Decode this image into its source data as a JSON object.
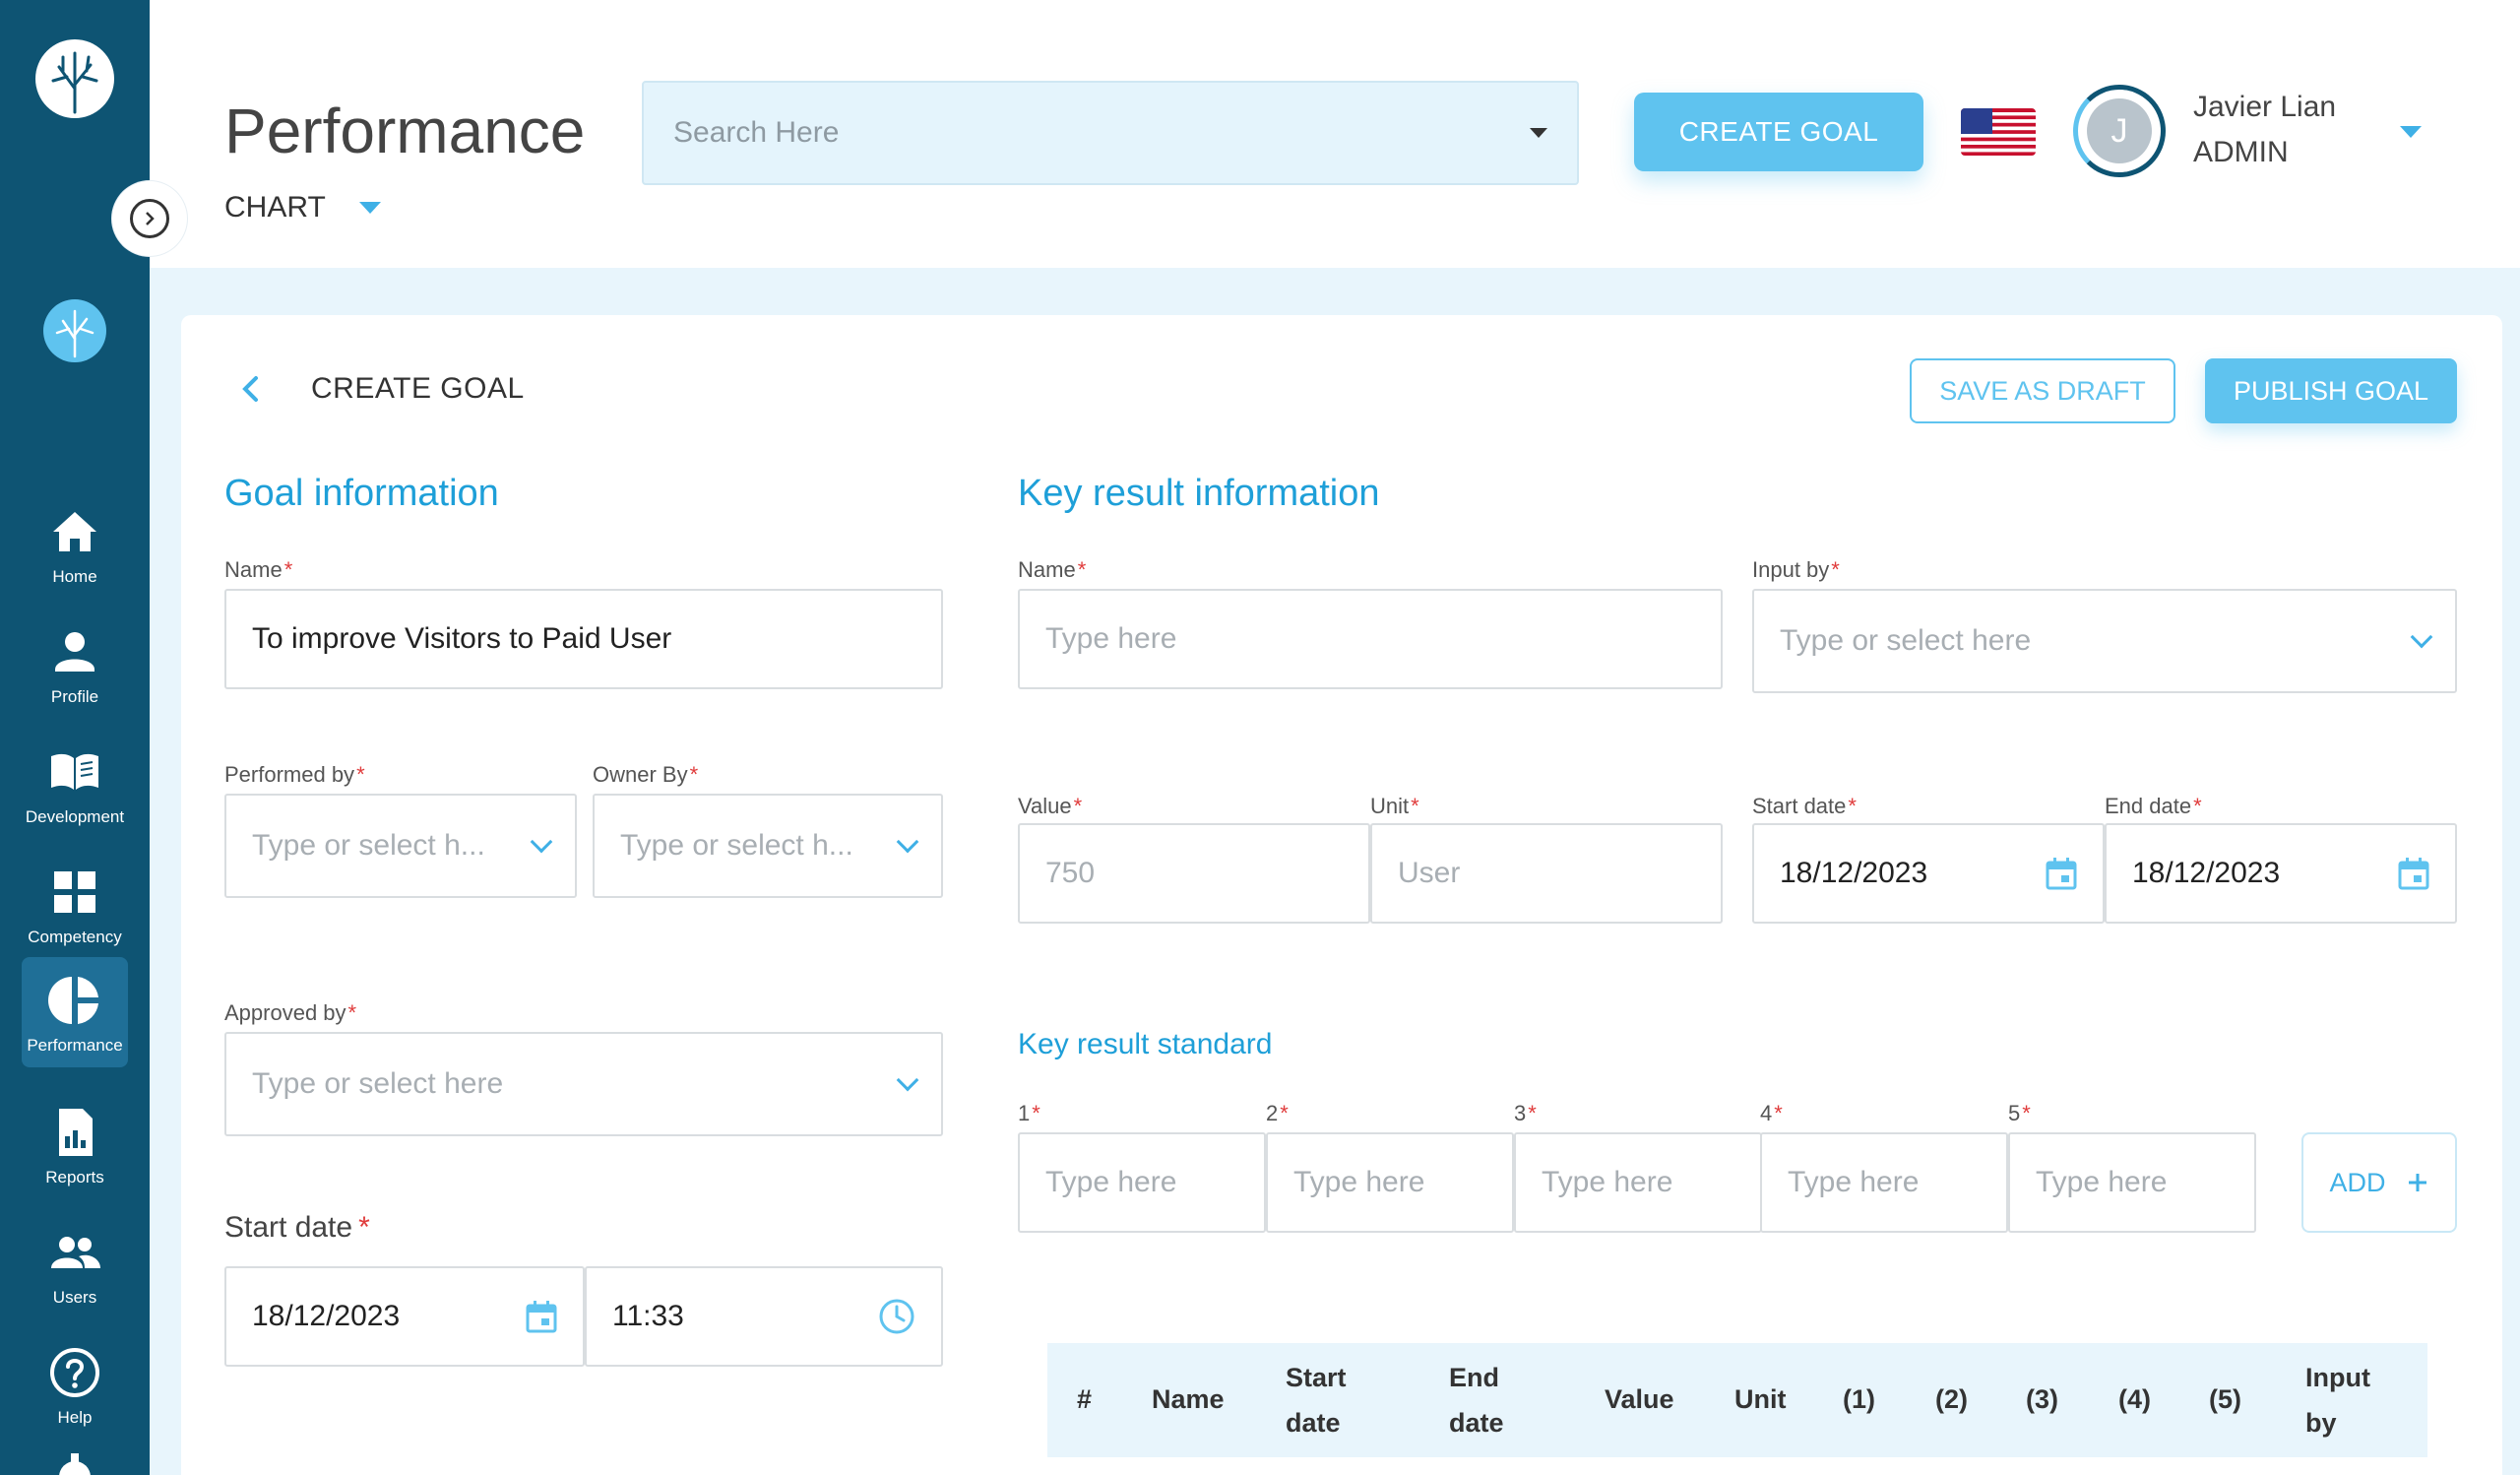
{
  "header": {
    "title": "Performance",
    "view_select": "CHART",
    "search_placeholder": "Search Here",
    "create_goal_label": "CREATE GOAL",
    "user_initial": "J",
    "user_name": "Javier Lian",
    "user_role": "ADMIN"
  },
  "sidebar": {
    "items": [
      {
        "label": "Home",
        "icon": "home-icon"
      },
      {
        "label": "Profile",
        "icon": "person-icon"
      },
      {
        "label": "Development",
        "icon": "book-icon"
      },
      {
        "label": "Competency",
        "icon": "grid-icon"
      },
      {
        "label": "Performance",
        "icon": "pie-chart-icon",
        "active": true
      },
      {
        "label": "Reports",
        "icon": "report-icon"
      },
      {
        "label": "Users",
        "icon": "users-icon"
      },
      {
        "label": "Help",
        "icon": "help-icon"
      }
    ]
  },
  "page": {
    "title": "CREATE GOAL",
    "save_draft_label": "SAVE AS DRAFT",
    "publish_label": "PUBLISH GOAL"
  },
  "goal_info": {
    "section_title": "Goal information",
    "name_label": "Name",
    "name_value": "To improve Visitors to Paid User",
    "performed_by_label": "Performed by",
    "performed_by_placeholder": "Type or select h...",
    "owner_by_label": "Owner By",
    "owner_by_placeholder": "Type or select h...",
    "approved_by_label": "Approved by",
    "approved_by_placeholder": "Type or select here",
    "start_date_label": "Start date",
    "start_date_value": "18/12/2023",
    "start_time_value": "11:33"
  },
  "key_result": {
    "section_title": "Key result information",
    "name_label": "Name",
    "name_placeholder": "Type here",
    "input_by_label": "Input by",
    "input_by_placeholder": "Type or select here",
    "value_label": "Value",
    "value_placeholder": "750",
    "unit_label": "Unit",
    "unit_placeholder": "User",
    "start_date_label": "Start date",
    "start_date_value": "18/12/2023",
    "end_date_label": "End date",
    "end_date_value": "18/12/2023",
    "standard_title": "Key result standard",
    "standards": [
      {
        "label": "1",
        "placeholder": "Type here"
      },
      {
        "label": "2",
        "placeholder": "Type here"
      },
      {
        "label": "3",
        "placeholder": "Type here"
      },
      {
        "label": "4",
        "placeholder": "Type here"
      },
      {
        "label": "5",
        "placeholder": "Type here"
      }
    ],
    "add_label": "ADD"
  },
  "table": {
    "headers": [
      "#",
      "Name",
      "Start date",
      "End date",
      "Value",
      "Unit",
      "(1)",
      "(2)",
      "(3)",
      "(4)",
      "(5)",
      "Input by"
    ]
  },
  "colors": {
    "sidebar": "#0e5473",
    "accent": "#5fc3ef",
    "heading": "#1e9fd8",
    "required": "#e03c3c"
  }
}
